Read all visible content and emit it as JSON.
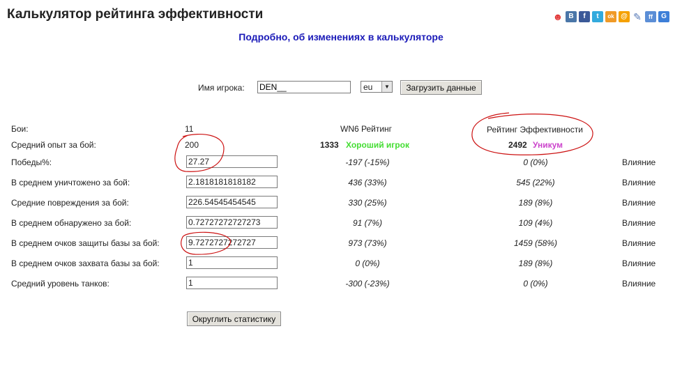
{
  "page": {
    "title": "Калькулятор рейтинга эффективности",
    "details_link": "Подробно, об изменениях в калькуляторе"
  },
  "share_icons": [
    {
      "name": "person-icon",
      "glyph": "☻",
      "color": "#e23a3a"
    },
    {
      "name": "vk-icon",
      "glyph": "В",
      "color": "#4a76a8"
    },
    {
      "name": "facebook-icon",
      "glyph": "f",
      "color": "#3b5998"
    },
    {
      "name": "twitter-icon",
      "glyph": "t",
      "color": "#33aadd"
    },
    {
      "name": "odnoklassniki-icon",
      "glyph": "ok",
      "color": "#f09a27"
    },
    {
      "name": "mail-icon",
      "glyph": "@",
      "color": "#f5a100"
    },
    {
      "name": "pencil-icon",
      "glyph": "✎",
      "color": "#5578b5"
    },
    {
      "name": "friendfeed-icon",
      "glyph": "ff",
      "color": "#5b8ed6"
    },
    {
      "name": "google-icon",
      "glyph": "G",
      "color": "#3d7fd8"
    }
  ],
  "form": {
    "player_label": "Имя игрока:",
    "player_value": "DEN__",
    "region_value": "eu",
    "load_button": "Загрузить данные"
  },
  "headers": {
    "wn6": "WN6 Рейтинг",
    "efficiency": "Рейтинг Эффективности"
  },
  "summary": {
    "battles_label": "Бои:",
    "battles_value": "11",
    "avg_xp_label": "Средний опыт за бой:",
    "avg_xp_value": "200",
    "wn6_score": "1333",
    "wn6_rank": "Хороший игрок",
    "eff_score": "2492",
    "eff_rank": "Уникум"
  },
  "rows": [
    {
      "label": "Победы%:",
      "value": "27.27",
      "wn6": "-197 (-15%)",
      "eff": "0 (0%)",
      "influence": "Влияние"
    },
    {
      "label": "В среднем уничтожено за бой:",
      "value": "2.1818181818182",
      "wn6": "436 (33%)",
      "eff": "545 (22%)",
      "influence": "Влияние"
    },
    {
      "label": "Средние повреждения за бой:",
      "value": "226.54545454545",
      "wn6": "330 (25%)",
      "eff": "189 (8%)",
      "influence": "Влияние"
    },
    {
      "label": "В среднем обнаружено за бой:",
      "value": "0.72727272727273",
      "wn6": "91 (7%)",
      "eff": "109 (4%)",
      "influence": "Влияние"
    },
    {
      "label": "В среднем очков защиты базы за бой:",
      "value": "9.7272727272727",
      "wn6": "973 (73%)",
      "eff": "1459 (58%)",
      "influence": "Влияние"
    },
    {
      "label": "В среднем очков захвата базы за бой:",
      "value": "1",
      "wn6": "0 (0%)",
      "eff": "189 (8%)",
      "influence": "Влияние"
    },
    {
      "label": "Средний уровень танков:",
      "value": "1",
      "wn6": "-300 (-23%)",
      "eff": "0 (0%)",
      "influence": "Влияние"
    }
  ],
  "round_button": "Округлить статистику",
  "annotation_color": "#cc1111"
}
